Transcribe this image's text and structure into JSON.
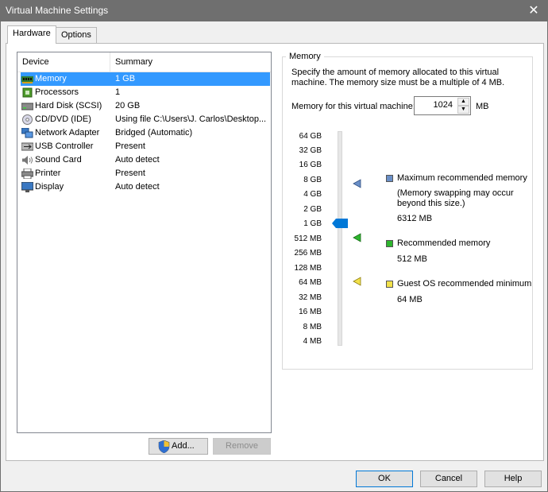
{
  "window": {
    "title": "Virtual Machine Settings"
  },
  "tabs": [
    {
      "label": "Hardware"
    },
    {
      "label": "Options"
    }
  ],
  "device_list": {
    "columns": [
      "Device",
      "Summary"
    ],
    "items": [
      {
        "name": "Memory",
        "summary": "1 GB",
        "icon": "memory-icon"
      },
      {
        "name": "Processors",
        "summary": "1",
        "icon": "processor-icon"
      },
      {
        "name": "Hard Disk (SCSI)",
        "summary": "20 GB",
        "icon": "hard-disk-icon"
      },
      {
        "name": "CD/DVD (IDE)",
        "summary": "Using file C:\\Users\\J. Carlos\\Desktop...",
        "icon": "cd-dvd-icon"
      },
      {
        "name": "Network Adapter",
        "summary": "Bridged (Automatic)",
        "icon": "network-adapter-icon"
      },
      {
        "name": "USB Controller",
        "summary": "Present",
        "icon": "usb-icon"
      },
      {
        "name": "Sound Card",
        "summary": "Auto detect",
        "icon": "speaker-icon"
      },
      {
        "name": "Printer",
        "summary": "Present",
        "icon": "printer-icon"
      },
      {
        "name": "Display",
        "summary": "Auto detect",
        "icon": "monitor-icon"
      }
    ],
    "selected": "Memory"
  },
  "buttons": {
    "add": "Add...",
    "remove": "Remove",
    "ok": "OK",
    "cancel": "Cancel",
    "help": "Help"
  },
  "memory": {
    "group_title": "Memory",
    "description": "Specify the amount of memory allocated to this virtual machine. The memory size must be a multiple of 4 MB.",
    "field_label": "Memory for this virtual machine:",
    "value": "1024",
    "unit": "MB",
    "slider_labels": [
      "64 GB",
      "32 GB",
      "16 GB",
      "8 GB",
      "4 GB",
      "2 GB",
      "1 GB",
      "512 MB",
      "256 MB",
      "128 MB",
      "64 MB",
      "32 MB",
      "16 MB",
      "8 MB",
      "4 MB"
    ],
    "current_level": "1 GB",
    "legend": {
      "max": {
        "label": "Maximum recommended memory",
        "note": "(Memory swapping may occur beyond this size.)",
        "value": "6312 MB",
        "color": "#6a8fc7",
        "level": "8 GB"
      },
      "recommended": {
        "label": "Recommended memory",
        "value": "512 MB",
        "color": "#2db52d",
        "level": "512 MB"
      },
      "guest_min": {
        "label": "Guest OS recommended minimum",
        "value": "64 MB",
        "color": "#f2e14a",
        "level": "64 MB"
      }
    }
  }
}
